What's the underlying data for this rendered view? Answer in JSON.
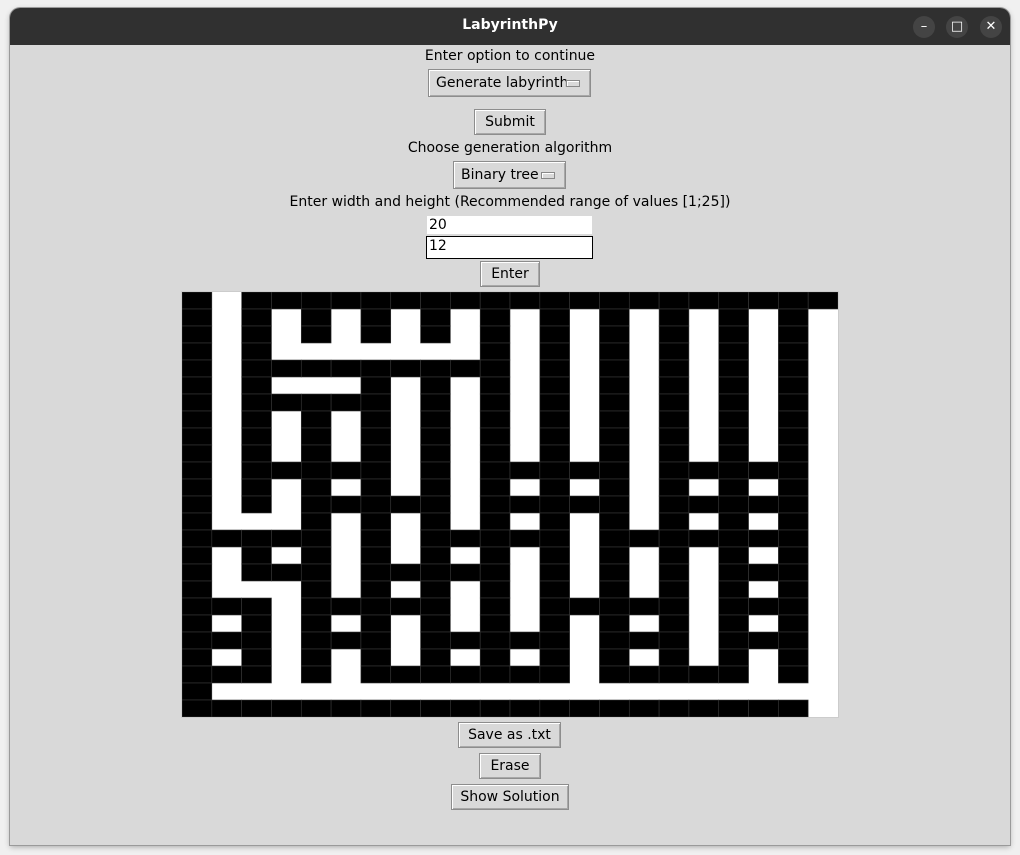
{
  "window": {
    "title": "LabyrinthPy",
    "minimize_icon": "minimize-icon",
    "maximize_icon": "maximize-icon",
    "close_icon": "close-icon"
  },
  "option": {
    "prompt": "Enter option to continue",
    "selected": "Generate labyrinth",
    "submit": "Submit"
  },
  "algorithm": {
    "prompt": "Choose generation algorithm",
    "selected": "Binary tree"
  },
  "size": {
    "prompt": "Enter width and height (Recommended range of values [1;25])",
    "width": "20",
    "height": "12",
    "enter": "Enter"
  },
  "maze": {
    "rows": [
      "#.####################",
      "#.#.#.#.#.#.#.#.#.#.#.",
      "#.#.#.#.#.#.#.#.#.#.#.",
      "#.#.......#.#.#.#.#.#.",
      "#.#########.#.#.#.#.#.",
      "#.#...#.#.#.#.#.#.#.#.",
      "#.#####.#.#.#.#.#.#.#.",
      "#.#.#.#.#.#.#.#.#.#.#.",
      "#.#.#.#.#.#.#.#.#.#.#.",
      "#.#.#.#.#.#.#.#.#.#.#.",
      "#.#####.#.#####.#####.",
      "#.#.#.#.#.#.#.#.#.#.#.",
      "#.#.#####.#####.#####.",
      "#...#.#.#.#.#.#.#.#.#.",
      "#####.#.#####.#######.",
      "#.#.#.#.#.#.#.#.#.#.#.",
      "#.###.#####.#.#.#.###.",
      "#...#.#.#.#.#.#.#.#.#.",
      "###.#####.#.#####.###.",
      "#.#.#.#.#.#.#.#.#.#.#.",
      "###.###.#####.###.###.",
      "#.#.#.#.#.#.#.#.#.#.#.",
      "###.#.#######.#####.#.",
      "#.....................",
      "#####################."
    ]
  },
  "actions": {
    "save": "Save as .txt",
    "erase": "Erase",
    "solution": "Show Solution"
  }
}
